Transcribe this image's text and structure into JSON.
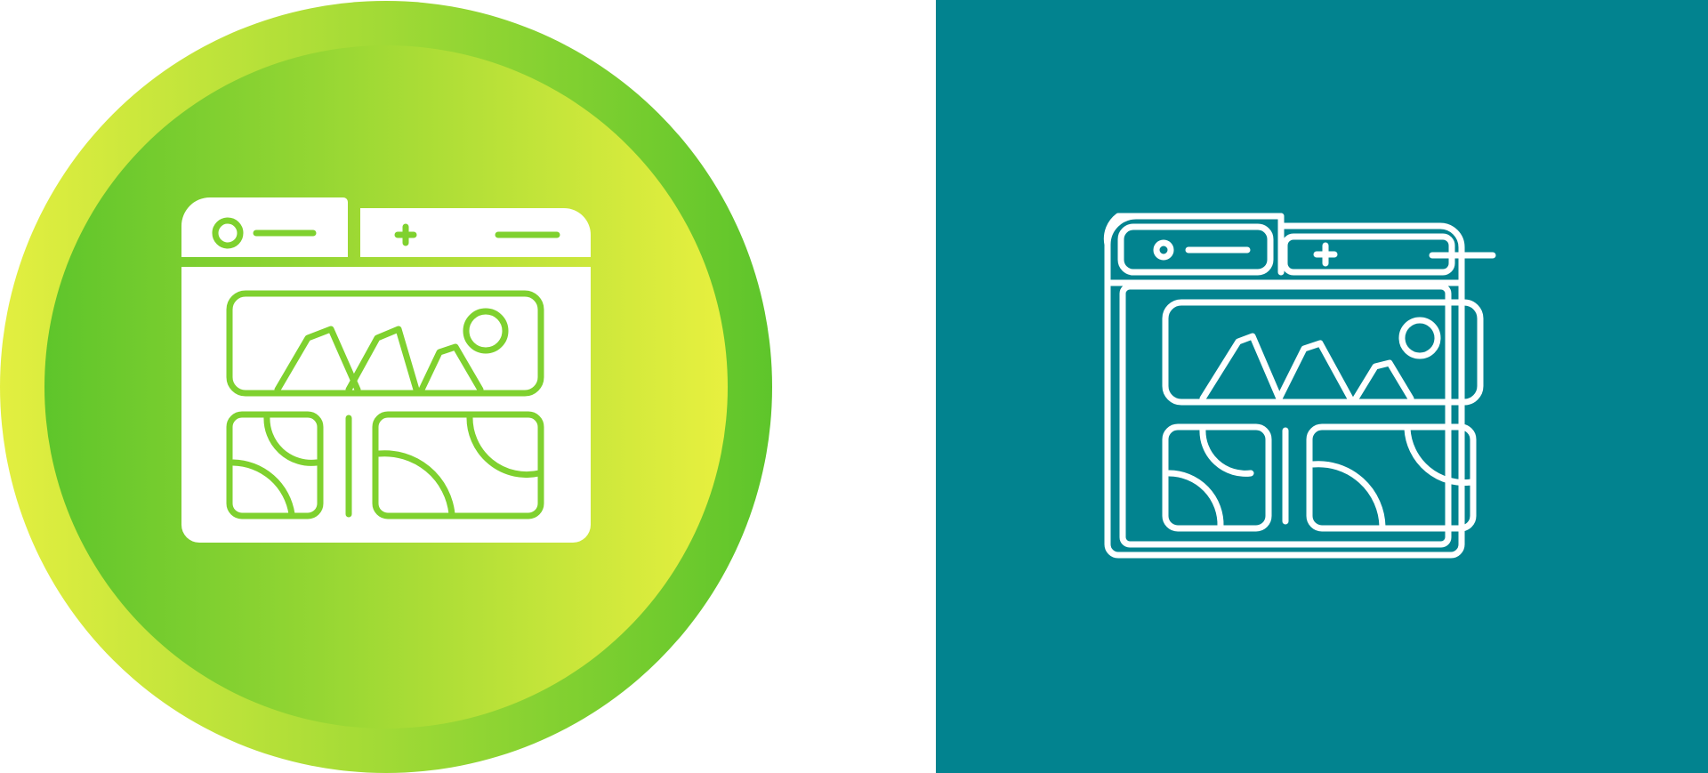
{
  "left_icon": {
    "name": "web-gallery-glyph-icon",
    "style": "glyph",
    "colors": {
      "outer_gradient": [
        "#e2ef3f",
        "#5ec62b"
      ],
      "inner_gradient": [
        "#5ec62b",
        "#e2ef3f"
      ],
      "glyph": "#ffffff",
      "glyph_lines": "#7fd12f"
    }
  },
  "right_icon": {
    "name": "web-gallery-outline-icon",
    "style": "outline",
    "colors": {
      "background": "#02838f",
      "stroke": "#ffffff"
    }
  }
}
